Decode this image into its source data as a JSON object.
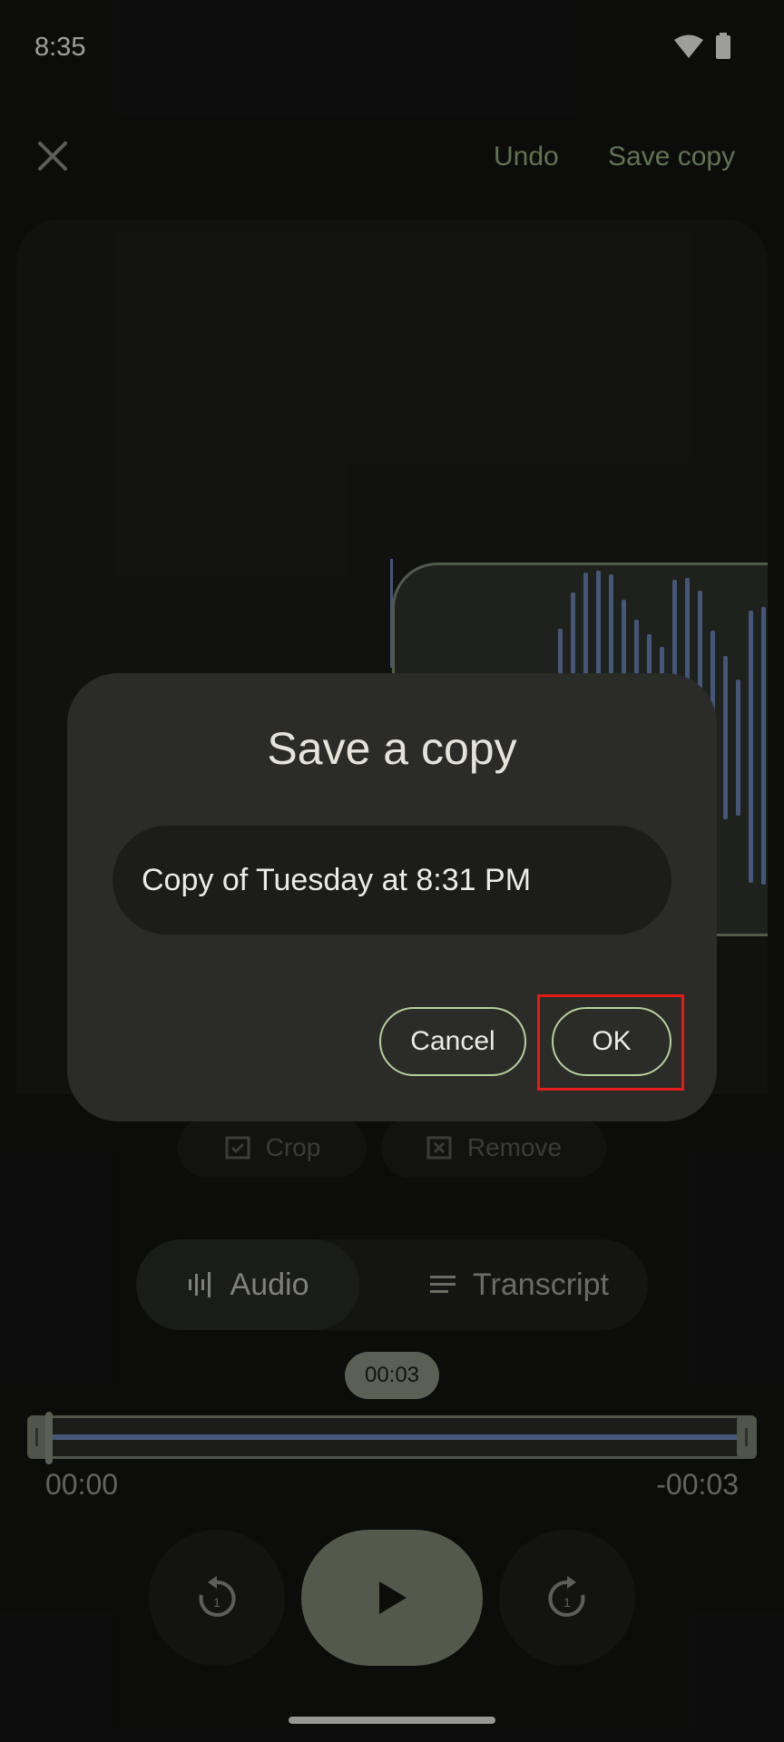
{
  "status": {
    "time": "8:35",
    "wifi_icon": "wifi-icon",
    "battery_icon": "battery-icon"
  },
  "toolbar": {
    "close_icon": "close-icon",
    "undo_label": "Undo",
    "save_copy_label": "Save copy"
  },
  "edit_chips": {
    "crop_label": "Crop",
    "remove_label": "Remove"
  },
  "view_toggle": {
    "audio_label": "Audio",
    "transcript_label": "Transcript",
    "selected": "Audio"
  },
  "playback": {
    "current_bubble": "00:03",
    "elapsed": "00:00",
    "remaining": "-00:03",
    "rewind_seconds": "1",
    "forward_seconds": "1"
  },
  "dialog": {
    "title": "Save a copy",
    "name_value": "Copy of Tuesday at 8:31 PM",
    "cancel_label": "Cancel",
    "ok_label": "OK"
  },
  "colors": {
    "accent": "#97b07e",
    "waveform": "#6a86bb",
    "highlight": "#e31b1b"
  }
}
